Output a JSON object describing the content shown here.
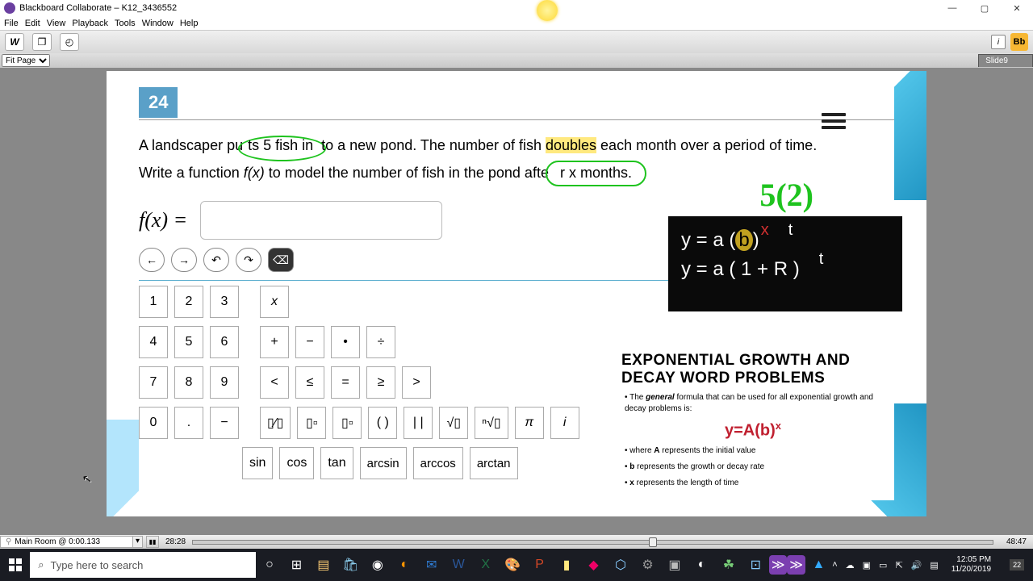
{
  "window": {
    "title": "Blackboard Collaborate – K12_3436552"
  },
  "menu": {
    "items": [
      "File",
      "Edit",
      "View",
      "Playback",
      "Tools",
      "Window",
      "Help"
    ]
  },
  "fit": {
    "label": "Fit Page"
  },
  "slide": {
    "name": "Slide9"
  },
  "question": {
    "number": "24",
    "line1a": "A landscaper pu",
    "line1_circ": "ts 5 fish in",
    "line1b": "to a new pond. The number of fish ",
    "line1_hl": "doubles",
    "line1c": " each month over a period of time.",
    "line2a": "Write a function ",
    "line2_fx": "f(x)",
    "line2b": " to model the number of fish in the pond afte",
    "line2_circ": "r x months.",
    "fx_label": "f(x)  ="
  },
  "controls": {
    "left": "←",
    "right": "→",
    "undo": "↶",
    "redo": "↷",
    "del": "⌫"
  },
  "keys": {
    "r1": [
      "1",
      "2",
      "3"
    ],
    "r1x": "x",
    "r2": [
      "4",
      "5",
      "6"
    ],
    "r2ops": [
      "+",
      "−",
      "•",
      "÷"
    ],
    "r3": [
      "7",
      "8",
      "9"
    ],
    "r3ops": [
      "<",
      "≤",
      "=",
      "≥",
      ">"
    ],
    "r4": [
      "0",
      ".",
      "−"
    ],
    "r4sym_frac": "▯⁄▯",
    "r4sym_pow": "▯▫",
    "r4sym_sub": "▯▫",
    "r4sym_paren": "( )",
    "r4sym_abs": "| |",
    "r4sym_sqrt": "√▯",
    "r4sym_nroot": "ⁿ√▯",
    "r4sym_pi": "π",
    "r4sym_i": "i",
    "r5": [
      "sin",
      "cos",
      "tan",
      "arcsin",
      "arccos",
      "arctan"
    ]
  },
  "handnote": "5(2)",
  "formula_box": {
    "line1_pre": "y = a (",
    "line1_b": "b",
    "line1_post": ")",
    "line2": "y = a ( 1 + R )",
    "sup_t": "t"
  },
  "info": {
    "title1": "EXPONENTIAL GROWTH AND",
    "title2": "DECAY WORD PROBLEMS",
    "general_pre": "The ",
    "general_b": "general",
    "general_post": " formula that can be used for all exponential growth and decay problems is:",
    "formula": "y=A(b)",
    "formula_sup": "x",
    "a_line": " represents the initial value",
    "b_line": " represents the growth or decay rate",
    "x_line": " represents the length of time",
    "where": "where "
  },
  "playback": {
    "room": "Main Room @ 0:00.133",
    "pause": "▮▮",
    "time_cur": "28:28",
    "time_end": "48:47"
  },
  "taskbar": {
    "search_placeholder": "Type here to search",
    "time": "12:05 PM",
    "date": "11/20/2019",
    "notif_count": "22"
  }
}
